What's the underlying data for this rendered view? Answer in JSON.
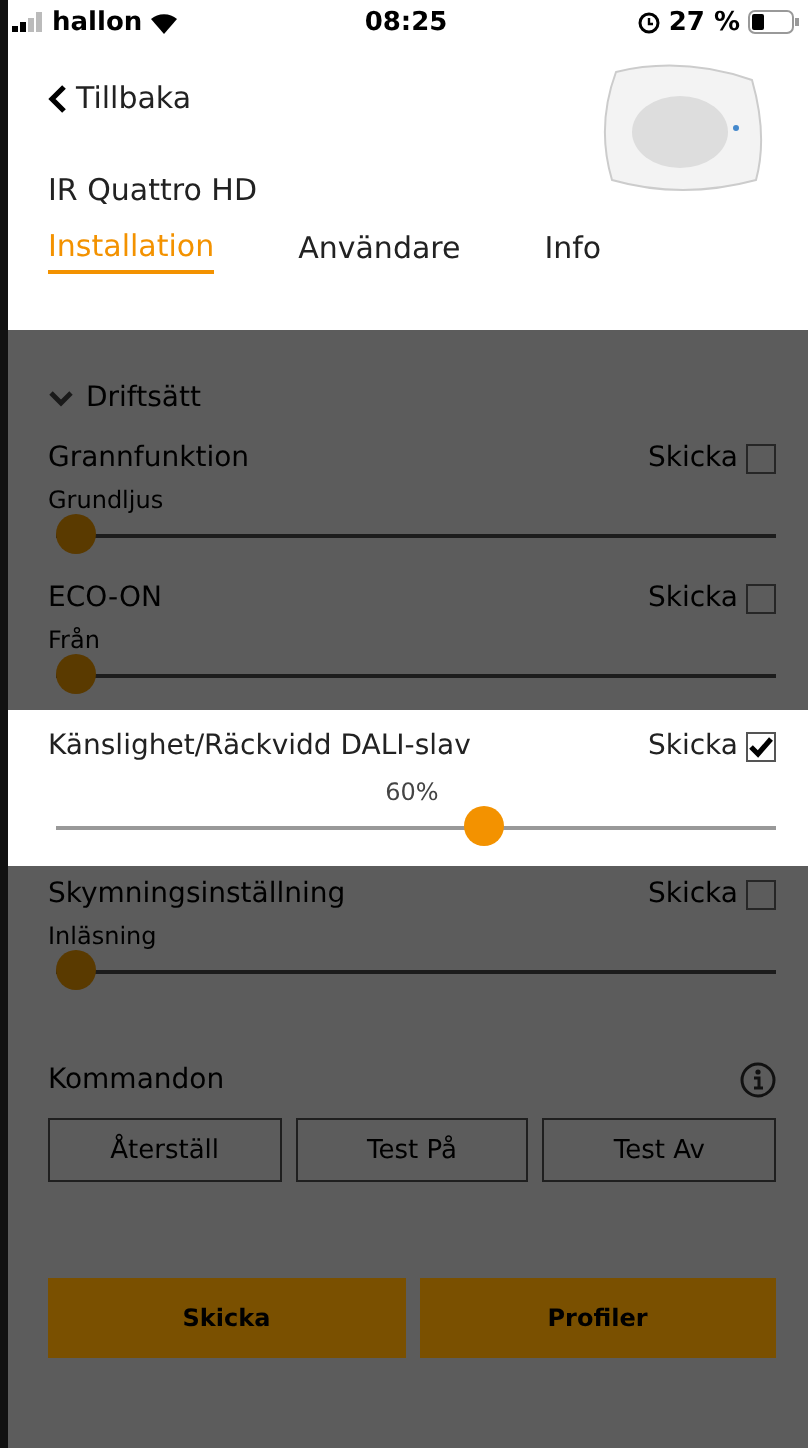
{
  "status_bar": {
    "carrier": "hallon",
    "time": "08:25",
    "battery": "27 %"
  },
  "header": {
    "back": "Tillbaka",
    "device_name": "IR Quattro HD"
  },
  "tabs": [
    {
      "label": "Installation",
      "selected": true
    },
    {
      "label": "Användare",
      "selected": false
    },
    {
      "label": "Info",
      "selected": false
    }
  ],
  "section": {
    "title": "Driftsätt",
    "expanded": true
  },
  "settings": [
    {
      "title": "Grannfunktion",
      "send_label": "Skicka",
      "checked": false,
      "highlighted": false,
      "value": "Grundljus",
      "level": 0
    },
    {
      "title": "ECO-ON",
      "send_label": "Skicka",
      "checked": false,
      "highlighted": false,
      "value": "Från",
      "level": 0
    },
    {
      "title": "Känslighet/Räckvidd DALI-slav",
      "send_label": "Skicka",
      "checked": true,
      "highlighted": true,
      "value": "60%",
      "level": 0.6
    },
    {
      "title": "Skymningsinställning",
      "send_label": "Skicka",
      "checked": false,
      "highlighted": false,
      "value": "Inläsning",
      "level": 0
    }
  ],
  "commands": {
    "title": "Kommandon",
    "buttons": [
      "Återställ",
      "Test På",
      "Test Av"
    ]
  },
  "footer_buttons": [
    "Skicka",
    "Profiler"
  ]
}
